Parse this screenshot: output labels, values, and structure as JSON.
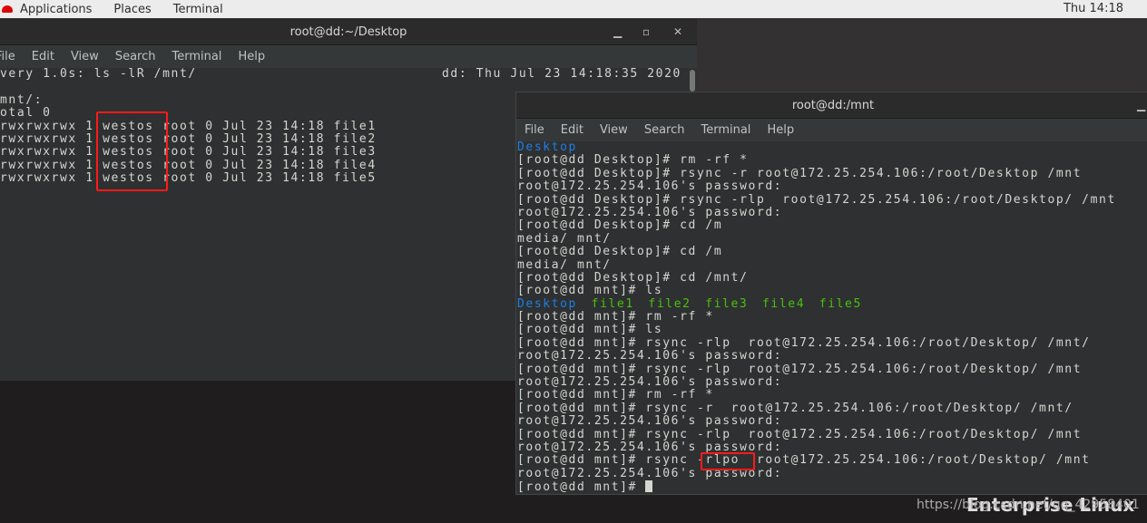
{
  "topbar": {
    "applications": "Applications",
    "places": "Places",
    "terminal": "Terminal",
    "clock": "Thu 14:18"
  },
  "win1": {
    "title": "root@dd:~/Desktop",
    "menu": [
      "File",
      "Edit",
      "View",
      "Search",
      "Terminal",
      "Help"
    ],
    "header_left": "very 1.0s: ls -lR /mnt/",
    "header_right": "dd: Thu Jul 23 14:18:35 2020",
    "lines": [
      "",
      "mnt/:",
      "otal 0",
      "rwxrwxrwx 1 westos root 0 Jul 23 14:18 file1",
      "rwxrwxrwx 1 westos root 0 Jul 23 14:18 file2",
      "rwxrwxrwx 1 westos root 0 Jul 23 14:18 file3",
      "rwxrwxrwx 1 westos root 0 Jul 23 14:18 file4",
      "rwxrwxrwx 1 westos root 0 Jul 23 14:18 file5"
    ]
  },
  "win2": {
    "title": "root@dd:/mnt",
    "menu": [
      "File",
      "Edit",
      "View",
      "Search",
      "Terminal",
      "Help"
    ],
    "first": "Desktop",
    "lines": [
      "[root@dd Desktop]# rm -rf *",
      "[root@dd Desktop]# rsync -r root@172.25.254.106:/root/Desktop /mnt",
      "root@172.25.254.106's password:",
      "[root@dd Desktop]# rsync -rlp  root@172.25.254.106:/root/Desktop/ /mnt",
      "root@172.25.254.106's password:",
      "[root@dd Desktop]# cd /m",
      "media/ mnt/",
      "[root@dd Desktop]# cd /m",
      "media/ mnt/",
      "[root@dd Desktop]# cd /mnt/",
      "[root@dd mnt]# ls"
    ],
    "ls_out": [
      "Desktop",
      "file1",
      "file2",
      "file3",
      "file4",
      "file5"
    ],
    "lines2": [
      "[root@dd mnt]# rm -rf *",
      "[root@dd mnt]# ls",
      "[root@dd mnt]# rsync -rlp  root@172.25.254.106:/root/Desktop/ /mnt/",
      "root@172.25.254.106's password:",
      "[root@dd mnt]# rsync -rlp  root@172.25.254.106:/root/Desktop/ /mnt",
      "root@172.25.254.106's password:",
      "[root@dd mnt]# rm -rf *",
      "[root@dd mnt]# rsync -r  root@172.25.254.106:/root/Desktop/ /mnt/",
      "root@172.25.254.106's password:",
      "[root@dd mnt]# rsync -rlp  root@172.25.254.106:/root/Desktop/ /mnt",
      "root@172.25.254.106's password:",
      "[root@dd mnt]# rsync -rlpo  root@172.25.254.106:/root/Desktop/ /mnt",
      "root@172.25.254.106's password:"
    ],
    "prompt": "[root@dd mnt]# "
  },
  "watermark": {
    "brand": "Enterprise Linux",
    "url": "https://blog.csdn.net/qq_42958401"
  },
  "colors": {
    "highlight": "#ff1a1a",
    "dir": "#1d7fe0",
    "file": "#4ac10a"
  }
}
